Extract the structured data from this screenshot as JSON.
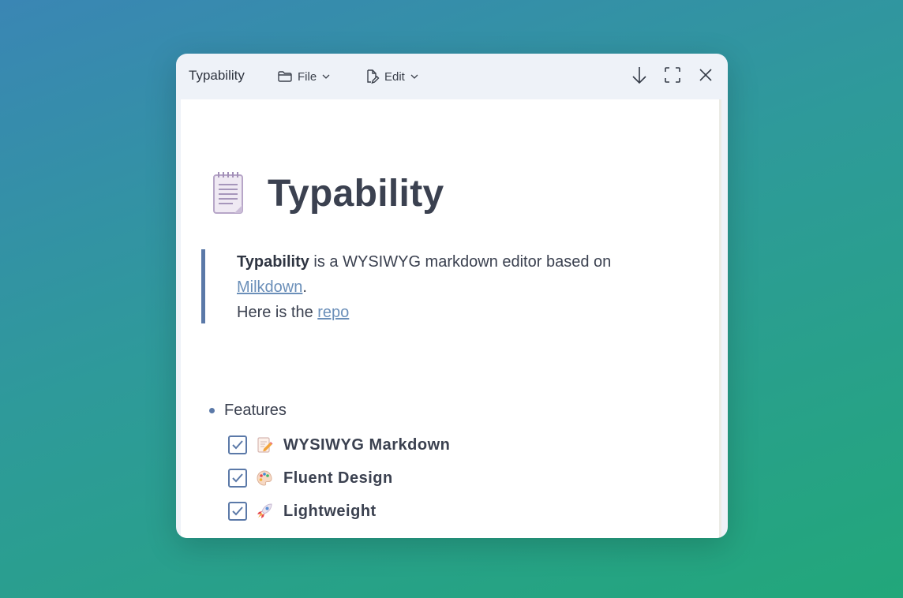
{
  "window": {
    "title": "Typability",
    "menus": [
      {
        "label": "File",
        "icon": "folder-icon"
      },
      {
        "label": "Edit",
        "icon": "edit-document-icon"
      }
    ],
    "controls": [
      "arrow-down-icon",
      "fullscreen-icon",
      "close-icon"
    ]
  },
  "document": {
    "heading": {
      "icon": "notepad-icon",
      "text": "Typability"
    },
    "quote": {
      "bold": "Typability",
      "text1": " is a WYSIWYG markdown editor based on",
      "link1": "Milkdown",
      "after_link1": ".",
      "text2": "Here is the ",
      "link2": "repo"
    },
    "list_item": "Features",
    "tasks": [
      {
        "label": "WYSIWYG Markdown",
        "checked": true,
        "emoji": "memo-icon"
      },
      {
        "label": "Fluent Design",
        "checked": true,
        "emoji": "palette-icon"
      },
      {
        "label": "Lightweight",
        "checked": true,
        "emoji": "rocket-icon"
      }
    ]
  },
  "colors": {
    "accent": "#5b79a8",
    "link": "#6b8fb9",
    "text": "#3b4150",
    "titlebar": "#eef2f8"
  }
}
